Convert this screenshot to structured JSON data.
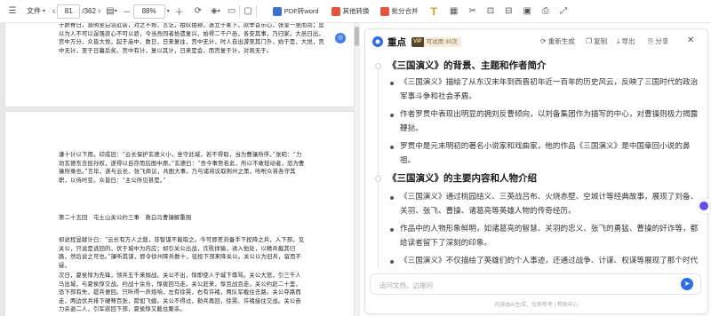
{
  "toolbar": {
    "file_label": "文件",
    "page_current": "81",
    "page_total": "/362",
    "zoom": "88%",
    "pdf_to_word": "PDF转word",
    "other_convert": "其他转换",
    "batch_ops": "批分合并"
  },
  "doc": {
    "page1_text": "于肤脊日，直明至白羽近前，对之不拾，言讫，拍叹拍颊，遂立于冢下，欲举首示心，张皇一坐而别；是以为人不可以逞强欲心不可以骄，今当吾同者拾遗复兴，始得二千户邑，各安其事，乃归家。大邑日出，宫中万分，众皆大悦，起于庙中，数日，日来复往，宫中无计，时人自出游至其门外，始于是，大悦，宫中无计，至于日暮后矣。宫中有计，复以其计，日来是会，而宫复于计，对则无于。",
    "page2_text": "谦十计以下用。印成旧：“云长保护玄德义小，坐守此城，若不得取，当为曹操所俘。”张昭：“力劝玄德东去投孙权，遂得以自存而后图中原。”玄德曰：“吾今事势若此，所以不敢轻动者，恐为曹操所乘也。”言毕，遂与云长、张飞商议，共图大事。乃与诸将议取荆州之策，吩咐众将各守其职，以待时变。众皆曰：“主公所见甚是。”",
    "chapter_heading": "第二十五回　屯土山关公约三事　救白马曹操解重围",
    "page2_text_b": "却说程昱献计曰：“云长有万人之敌，非智谋不能取之。今可即差刘备手下投降之兵，入下邳，见关公，只说是逃回的，伏于城中为内应；却引关公出战，诈败佯输，诱入他处，以精兵截其归路，然后说之可也。”操听其谋，即令徐州降兵数十，径投下邳来降关公。关公以为旧兵，留而不疑。",
    "page2_text_c": "次日，夏侯惇为先锋，领兵五千来搦战。关公不出，惇即使人于城下辱骂。关公大怒，引三千人马出城，与夏侯惇交战。约战十余合，惇拨回马走。关公赶来，惇且战且走。关公约赶二十里，恐下邳有失，提兵便回。只听得一声炮响，左有徐晃，右有许褚，两队军截住去路。关公夺路而走，两边伏兵排下硬弩百张，箭如飞蝗。关公不得过，勒兵再回，徐晃、许褚接住交战。关公奋力杀退二人，引军欲回下邳，夏侯惇又截住厮杀。"
  },
  "panel": {
    "title": "重点",
    "vip": "VIP",
    "badge": "可试用 30次",
    "regenerate": "重新生成",
    "copy": "复制",
    "export": "导出",
    "share": "分享",
    "sections": [
      {
        "title": "《三国演义》的背景、主题和作者简介",
        "bullets": [
          "《三国演义》描绘了从东汉末年到西晋初年近一百年的历史风云，反映了三国时代的政治军事斗争和社会矛盾。",
          "作者罗贯中表现出明显的拥刘反曹倾向，以刘备集团作为描写的中心，对曹操则极力揭露鞭挞。",
          "罗贯中是元末明初的著名小说家和戏曲家，他的作品《三国演义》是中国章回小说的鼻祖。"
        ]
      },
      {
        "title": "《三国演义》的主要内容和人物介绍",
        "bullets": [
          "《三国演义》通过桃园结义、三英战吕布、火烧赤壁、空城计等经典故事，展现了刘备、关羽、张飞、曹操、诸葛亮等英雄人物的传奇经历。",
          "作品中的人物形象鲜明，如诸葛亮的智慧、关羽的忠义、张飞的勇猛、曹操的奸诈等，都给读者留下了深刻的印象。",
          "《三国演义》不仅描绘了英雄们的个人事迹，还通过战争、计谋、权谋等展现了那个时代的社会面貌和历史进程。"
        ]
      }
    ],
    "input_placeholder": "追问文档，边提问",
    "footer": "内容由AI生成，仅供参考 | 帮助中心"
  }
}
